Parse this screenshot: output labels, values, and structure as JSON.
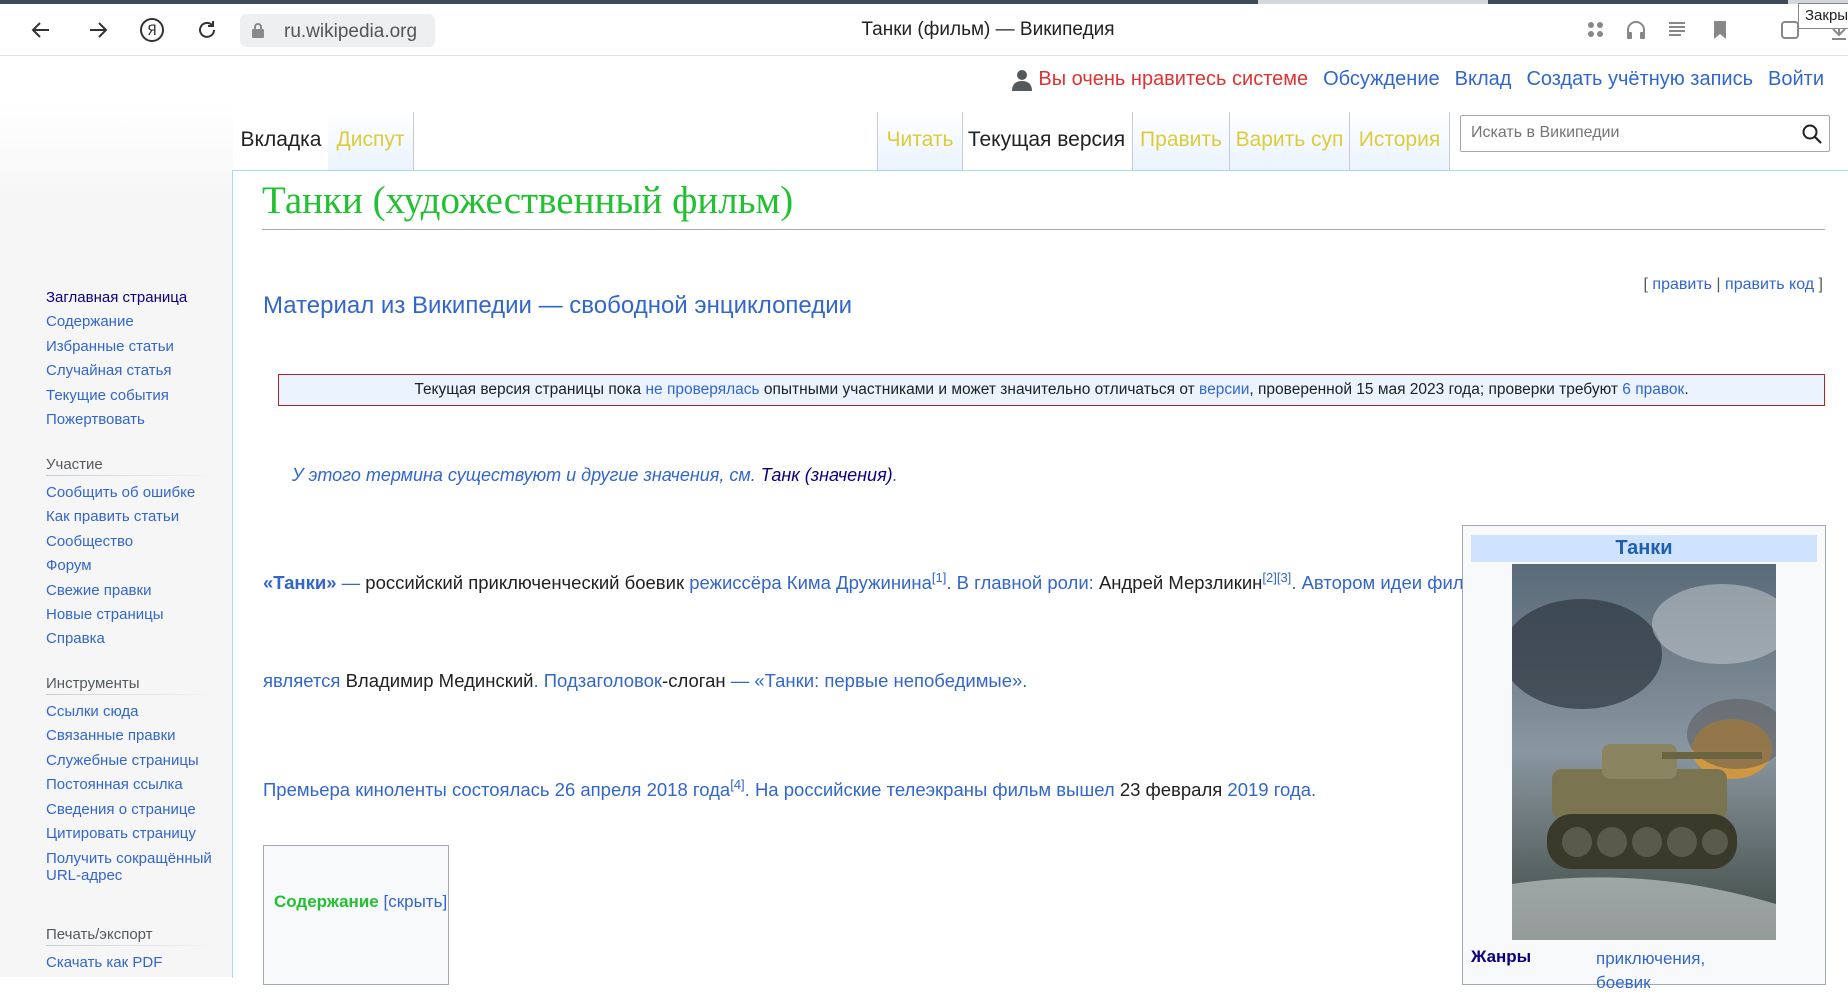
{
  "browser": {
    "url": "ru.wikipedia.org",
    "tab_title": "Танки (фильм) — Википедия",
    "tooltip": "Закры"
  },
  "personal": {
    "user_message": "Вы очень нравитесь системе",
    "links": [
      "Обсуждение",
      "Вклад",
      "Создать учётную запись",
      "Войти"
    ]
  },
  "sidebar": {
    "nav": [
      "Заглавная страница",
      "Содержание",
      "Избранные статьи",
      "Случайная статья",
      "Текущие события",
      "Пожертвовать"
    ],
    "participation": {
      "heading": "Участие",
      "items": [
        "Сообщить об ошибке",
        "Как править статьи",
        "Сообщество",
        "Форум",
        "Свежие правки",
        "Новые страницы",
        "Справка"
      ]
    },
    "tools": {
      "heading": "Инструменты",
      "items": [
        "Ссылки сюда",
        "Связанные правки",
        "Служебные страницы",
        "Постоянная ссылка",
        "Сведения о странице",
        "Цитировать страницу",
        "Получить сокращённый URL-адрес"
      ]
    },
    "print": {
      "heading": "Печать/экспорт",
      "items": [
        "Скачать как PDF"
      ]
    }
  },
  "tabs": {
    "left": [
      "Вкладка",
      "Диспут"
    ],
    "right": [
      "Читать",
      "Текущая версия",
      "Править",
      "Варить суп",
      "История"
    ]
  },
  "search": {
    "placeholder": "Искать в Википедии"
  },
  "article": {
    "title": "Танки (художественный фильм)",
    "tagline": "Материал из Википедии — свободной энциклопедии",
    "edit_open": "[ ",
    "edit_link": "править",
    "edit_sep": " | ",
    "edit_code": "править код",
    "edit_close": " ]",
    "notice": {
      "t1": "Текущая версия страницы пока ",
      "l1": "не проверялась",
      "t2": " опытными участниками и может значительно отличаться от ",
      "l2": "версии",
      "t3": ", проверенной 15 мая 2023 года; проверки требуют ",
      "l3": "6 правок",
      "t4": "."
    },
    "hatnote": {
      "t1": "У этого термина существуют и другие значения, см. ",
      "l1": "Танк (значения)",
      "t2": "."
    },
    "p1": {
      "bold": "«Танки»",
      "a": " — ",
      "b": "российский приключенческий боевик ",
      "c": "режиссёра Кима Дружинина",
      "r1": "[1]",
      "d": ". В главной роли: ",
      "e": "Андрей Мерзликин",
      "r2": "[2][3]",
      "f": ". Автором идеи фильма"
    },
    "p2": {
      "a": "является ",
      "b": "Владимир Мединский",
      "c": ". Подзаголовок",
      "d": "-слоган",
      "e": " — «Танки: первые непобедимые»."
    },
    "p3": {
      "a": "Премьера киноленты состоялась 26 апреля 2018 года",
      "r4": "[4]",
      "b": ". На российские телеэкраны фильм вышел ",
      "c": "23 февраля",
      "d": " 2019 года."
    },
    "toc": {
      "title": "Содержание",
      "toggle": "[скрыть]"
    }
  },
  "infobox": {
    "title": "Танки",
    "genre_label": "Жанры",
    "genre_values": [
      "приключения,",
      "боевик"
    ]
  }
}
